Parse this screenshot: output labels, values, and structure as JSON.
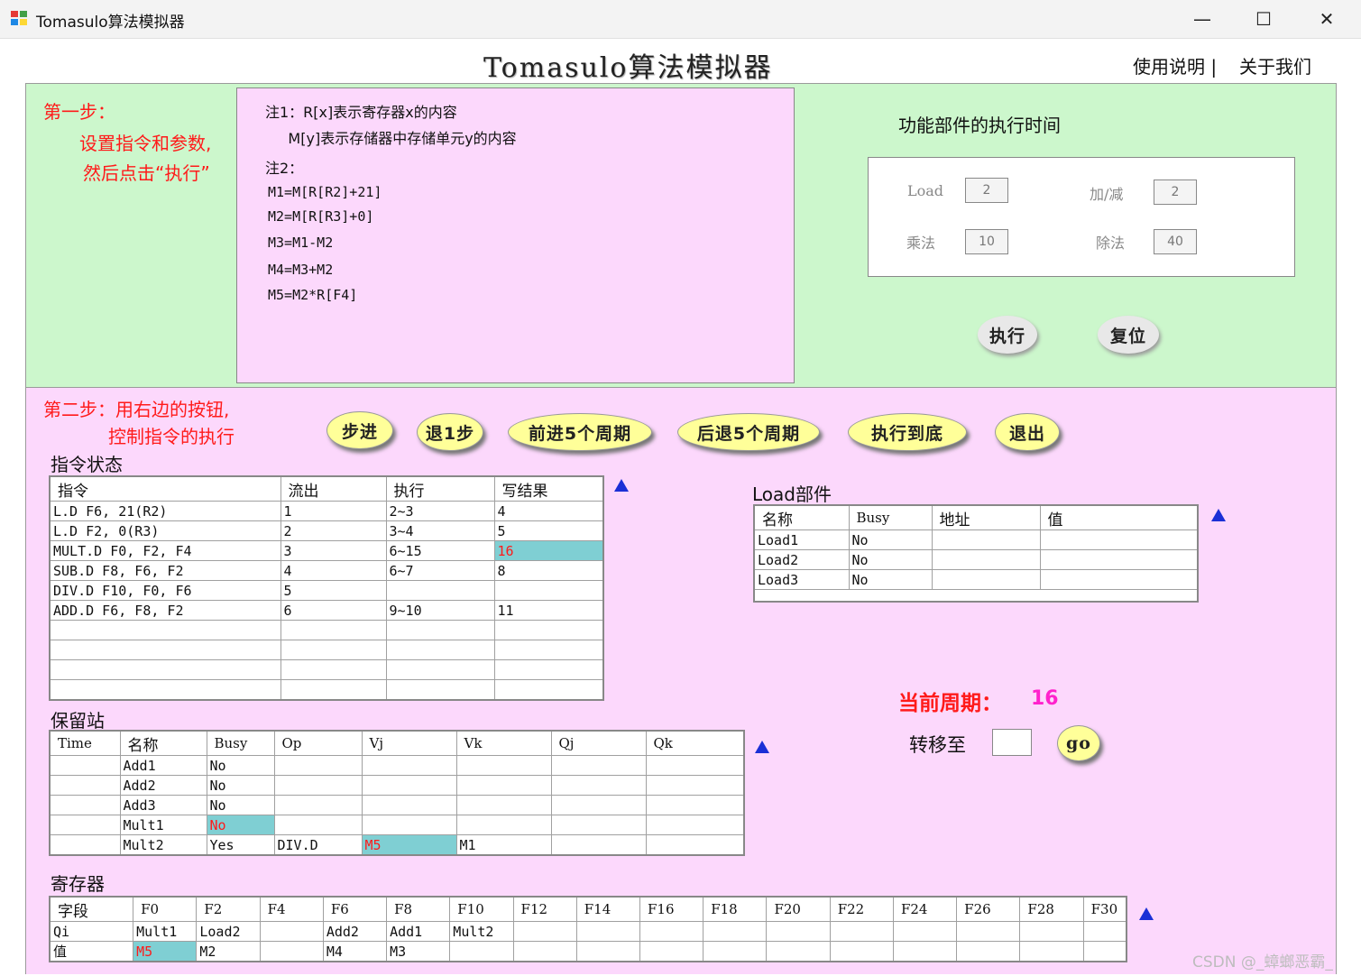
{
  "window": {
    "title": "Tomasulo算法模拟器",
    "controls": {
      "minimize": "—",
      "maximize": "☐",
      "close": "✕"
    }
  },
  "header": {
    "app_title": "Tomasulo算法模拟器",
    "help_link": "使用说明 |",
    "about_link": "关于我们"
  },
  "step1": {
    "title": "第一步：",
    "line1": "设置指令和参数,",
    "line2": "然后点击“执行”",
    "notes": [
      "注1：R[x]表示寄存器x的内容",
      "     M[y]表示存储器中存储单元y的内容",
      "注2：",
      "M1=M[R[R2]+21]",
      "M2=M[R[R3]+0]",
      "M3=M1-M2",
      "M4=M3+M2",
      "M5=M2*R[F4]"
    ],
    "fu_title": "功能部件的执行时间",
    "fu": {
      "load_label": "Load",
      "load_value": "2",
      "add_label": "加/减",
      "add_value": "2",
      "mul_label": "乘法",
      "mul_value": "10",
      "div_label": "除法",
      "div_value": "40"
    },
    "run_button": "执行",
    "reset_button": "复位"
  },
  "step2": {
    "line1": "第二步：用右边的按钮,",
    "line2": "控制指令的执行",
    "buttons": {
      "step": "步进",
      "back1": "退1步",
      "fwd5": "前进5个周期",
      "back5": "后退5个周期",
      "run_end": "执行到底",
      "exit": "退出"
    }
  },
  "instr_status": {
    "title": "指令状态",
    "headers": [
      "指令",
      "流出",
      "执行",
      "写结果"
    ],
    "rows": [
      [
        "L.D    F6, 21(R2)",
        "1",
        "2~3",
        "4"
      ],
      [
        "L.D    F2, 0(R3)",
        "2",
        "3~4",
        "5"
      ],
      [
        "MULT.D F0, F2, F4",
        "3",
        "6~15",
        "16"
      ],
      [
        "SUB.D  F8, F6, F2",
        "4",
        "6~7",
        "8"
      ],
      [
        "DIV.D  F10, F0, F6",
        "5",
        "",
        ""
      ],
      [
        "ADD.D  F6, F8, F2",
        "6",
        "9~10",
        "11"
      ],
      [
        "",
        "",
        "",
        ""
      ],
      [
        "",
        "",
        "",
        ""
      ],
      [
        "",
        "",
        "",
        ""
      ],
      [
        "",
        "",
        "",
        ""
      ]
    ]
  },
  "load_unit": {
    "title": "Load部件",
    "headers": [
      "名称",
      "Busy",
      "地址",
      "值"
    ],
    "rows": [
      [
        "Load1",
        "No",
        "",
        ""
      ],
      [
        "Load2",
        "No",
        "",
        ""
      ],
      [
        "Load3",
        "No",
        "",
        ""
      ]
    ]
  },
  "cycle": {
    "label": "当前周期：",
    "value": "16",
    "goto_label": "转移至",
    "goto_value": "",
    "go_button": "go"
  },
  "reservation": {
    "title": "保留站",
    "headers": [
      "Time",
      "名称",
      "Busy",
      "Op",
      "Vj",
      "Vk",
      "Qj",
      "Qk"
    ],
    "rows": [
      [
        "",
        "Add1",
        "No",
        "",
        "",
        "",
        "",
        ""
      ],
      [
        "",
        "Add2",
        "No",
        "",
        "",
        "",
        "",
        ""
      ],
      [
        "",
        "Add3",
        "No",
        "",
        "",
        "",
        "",
        ""
      ],
      [
        "",
        "Mult1",
        "No",
        "",
        "",
        "",
        "",
        ""
      ],
      [
        "",
        "Mult2",
        "Yes",
        "DIV.D",
        "M5",
        "M1",
        "",
        ""
      ]
    ]
  },
  "registers": {
    "title": "寄存器",
    "headers": [
      "字段",
      "F0",
      "F2",
      "F4",
      "F6",
      "F8",
      "F10",
      "F12",
      "F14",
      "F16",
      "F18",
      "F20",
      "F22",
      "F24",
      "F26",
      "F28",
      "F30"
    ],
    "rows": [
      [
        "Qi",
        "Mult1",
        "Load2",
        "",
        "Add2",
        "Add1",
        "Mult2",
        "",
        "",
        "",
        "",
        "",
        "",
        "",
        "",
        "",
        ""
      ],
      [
        "值",
        "M5",
        "M2",
        "",
        "M4",
        "M3",
        "",
        "",
        "",
        "",
        "",
        "",
        "",
        "",
        "",
        "",
        ""
      ]
    ]
  },
  "watermark": "CSDN @_蟑螂恶霸_",
  "colors": {
    "step1_bg": "#ccf7cc",
    "step2_bg": "#fcd8fc",
    "highlight": "#7fcfd3",
    "button": "#ffff99",
    "accent_red": "#ff1a1a"
  }
}
